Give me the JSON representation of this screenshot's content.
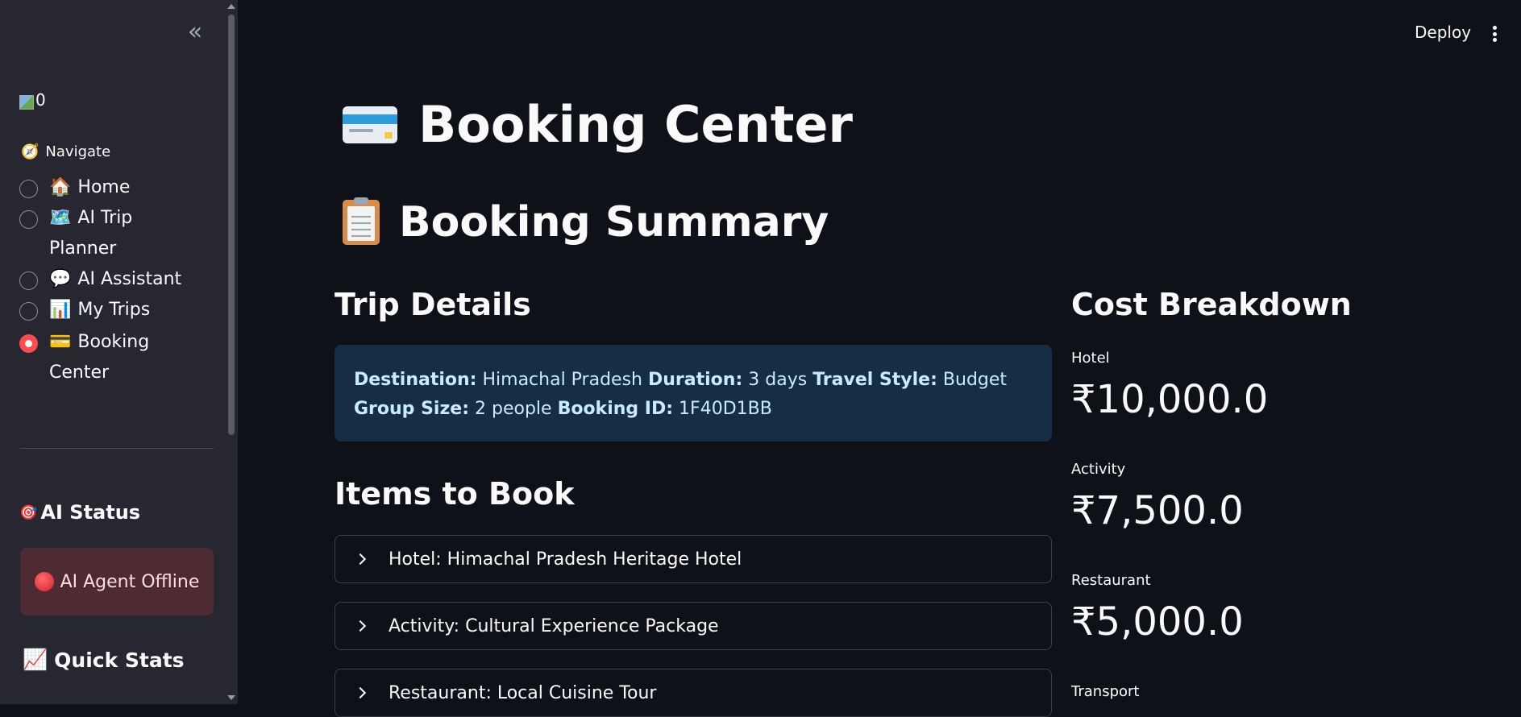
{
  "sidebar": {
    "collapse_icon": "«",
    "logo_alt": "0",
    "nav_label": "Navigate",
    "nav_icon": "compass-icon",
    "nav_items": [
      {
        "emoji": "🏠",
        "label": "Home",
        "selected": false
      },
      {
        "emoji": "🗺️",
        "label": "AI Trip Planner",
        "selected": false
      },
      {
        "emoji": "💬",
        "label": "AI Assistant",
        "selected": false
      },
      {
        "emoji": "📊",
        "label": "My Trips",
        "selected": false
      },
      {
        "emoji": "💳",
        "label": "Booking Center",
        "selected": true
      }
    ],
    "ai_status_title": "AI Status",
    "ai_status_icon": "🎯",
    "ai_status_message": "AI Agent Offline",
    "quick_stats_title": "Quick Stats",
    "quick_stats_icon": "📈"
  },
  "topbar": {
    "deploy_label": "Deploy",
    "menu_icon": "kebab-menu-icon"
  },
  "main": {
    "title": "Booking Center",
    "title_icon": "credit-card-icon",
    "subtitle": "Booking Summary",
    "subtitle_icon": "clipboard-icon",
    "trip_details_heading": "Trip Details",
    "trip": {
      "destination_label": "Destination:",
      "destination": "Himachal Pradesh",
      "duration_label": "Duration:",
      "duration": "3 days",
      "style_label": "Travel Style:",
      "style": "Budget",
      "group_label": "Group Size:",
      "group": "2 people",
      "booking_id_label": "Booking ID:",
      "booking_id": "1F40D1BB"
    },
    "items_heading": "Items to Book",
    "items": [
      {
        "label": "Hotel: Himachal Pradesh Heritage Hotel"
      },
      {
        "label": "Activity: Cultural Experience Package"
      },
      {
        "label": "Restaurant: Local Cuisine Tour"
      }
    ],
    "cost_heading": "Cost Breakdown",
    "costs": [
      {
        "label": "Hotel",
        "value": "₹10,000.0"
      },
      {
        "label": "Activity",
        "value": "₹7,500.0"
      },
      {
        "label": "Restaurant",
        "value": "₹5,000.0"
      },
      {
        "label": "Transport",
        "value": ""
      }
    ]
  },
  "colors": {
    "background": "#0e1117",
    "sidebar": "#262730",
    "accent_red": "#ff4b4b",
    "info_box": "#172d43",
    "error_box": "#4e2b33"
  }
}
